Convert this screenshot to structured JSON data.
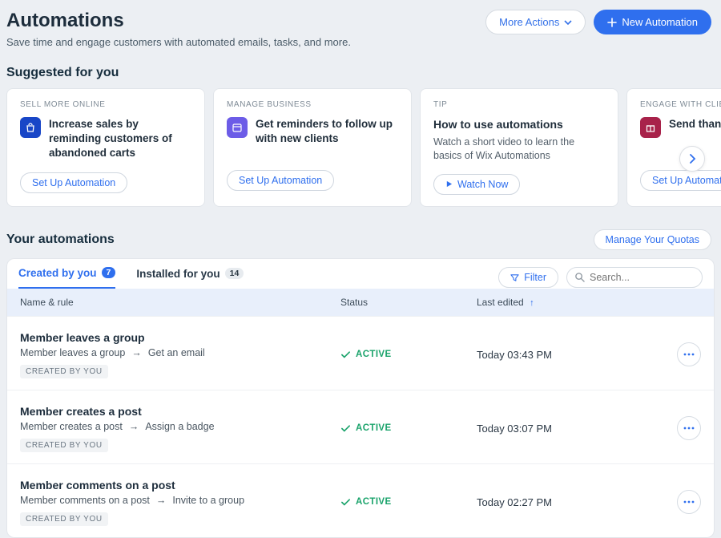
{
  "header": {
    "title": "Automations",
    "subtitle": "Save time and engage customers with automated emails, tasks, and more.",
    "more_actions": "More Actions",
    "new_automation": "New Automation"
  },
  "suggested": {
    "heading": "Suggested for you",
    "cards": [
      {
        "tag": "SELL MORE ONLINE",
        "title": "Increase sales by reminding customers of abandoned carts",
        "desc": "",
        "action": "Set Up Automation",
        "icon": "bag",
        "icon_class": "icon-bag-blue"
      },
      {
        "tag": "MANAGE BUSINESS",
        "title": "Get reminders to follow up with new clients",
        "desc": "",
        "action": "Set Up Automation",
        "icon": "calendar",
        "icon_class": "icon-cal-purple"
      },
      {
        "tag": "TIP",
        "title": "How to use automations",
        "desc": "Watch a short video to learn the basics of Wix Automations",
        "action": "Watch Now",
        "icon": "",
        "icon_class": "",
        "play": true
      },
      {
        "tag": "ENGAGE WITH CLIENTS",
        "title": "Send thank … who su … t",
        "desc": "",
        "action": "Set Up Automation",
        "icon": "gift",
        "icon_class": "icon-gift-red"
      }
    ]
  },
  "your_autos": {
    "heading": "Your automations",
    "manage_quotas": "Manage Your Quotas"
  },
  "tabs": {
    "created": "Created by you",
    "created_count": "7",
    "installed": "Installed for you",
    "installed_count": "14",
    "filter": "Filter",
    "search_placeholder": "Search..."
  },
  "table": {
    "col_name": "Name & rule",
    "col_status": "Status",
    "col_edited": "Last edited",
    "rows": [
      {
        "name": "Member leaves a group",
        "trigger": "Member leaves a group",
        "action": "Get an email",
        "tag": "CREATED BY YOU",
        "status": "ACTIVE",
        "edited": "Today 03:43 PM"
      },
      {
        "name": "Member creates a post",
        "trigger": "Member creates a post",
        "action": "Assign a badge",
        "tag": "CREATED BY YOU",
        "status": "ACTIVE",
        "edited": "Today 03:07 PM"
      },
      {
        "name": "Member comments on a post",
        "trigger": "Member comments on a post",
        "action": "Invite to a group",
        "tag": "CREATED BY YOU",
        "status": "ACTIVE",
        "edited": "Today 02:27 PM"
      }
    ]
  }
}
